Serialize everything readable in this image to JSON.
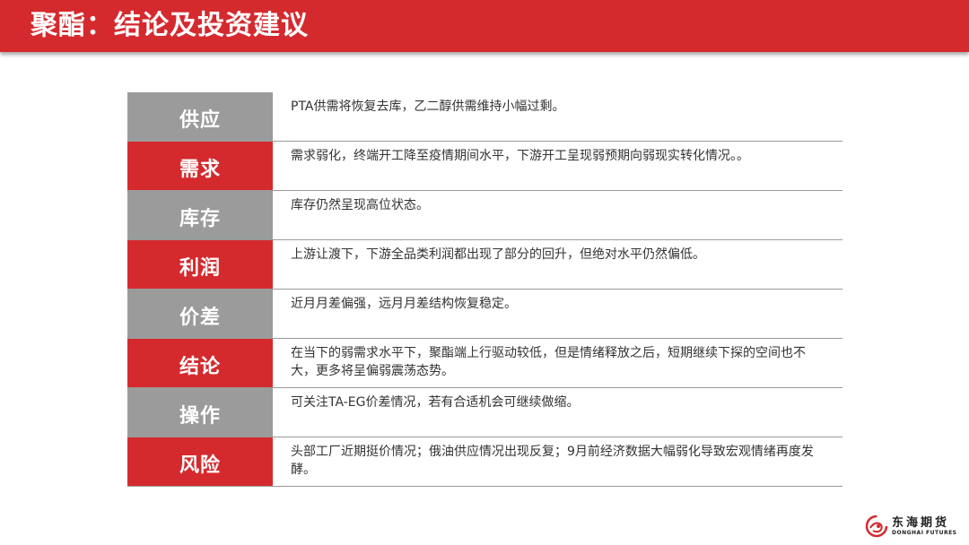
{
  "title": "聚酯：结论及投资建议",
  "rows": [
    {
      "label": "供应",
      "style": "gray",
      "text": "PTA供需将恢复去库，乙二醇供需维持小幅过剩。"
    },
    {
      "label": "需求",
      "style": "red",
      "text": "需求弱化，终端开工降至疫情期间水平，下游开工呈现弱预期向弱现实转化情况。。"
    },
    {
      "label": "库存",
      "style": "gray",
      "text": "库存仍然呈现高位状态。"
    },
    {
      "label": "利润",
      "style": "red",
      "text": "上游让渡下，下游全品类利润都出现了部分的回升，但绝对水平仍然偏低。"
    },
    {
      "label": "价差",
      "style": "gray",
      "text": "近月月差偏强，远月月差结构恢复稳定。"
    },
    {
      "label": "结论",
      "style": "red",
      "text": "在当下的弱需求水平下，聚酯端上行驱动较低，但是情绪释放之后，短期继续下探的空间也不大，更多将呈偏弱震荡态势。"
    },
    {
      "label": "操作",
      "style": "gray",
      "text": "可关注TA-EG价差情况，若有合适机会可继续做缩。"
    },
    {
      "label": "风险",
      "style": "red",
      "text": "头部工厂近期挺价情况；俄油供应情况出现反复；9月前经济数据大幅弱化导致宏观情绪再度发酵。"
    }
  ],
  "logo": {
    "name_cn": "东海期货",
    "name_en": "DONGHAI FUTURES",
    "icon": "donghai-logo-icon",
    "color": "#d42a2e"
  },
  "colors": {
    "accent": "#d42a2e",
    "label_gray": "#9b9b9b"
  }
}
